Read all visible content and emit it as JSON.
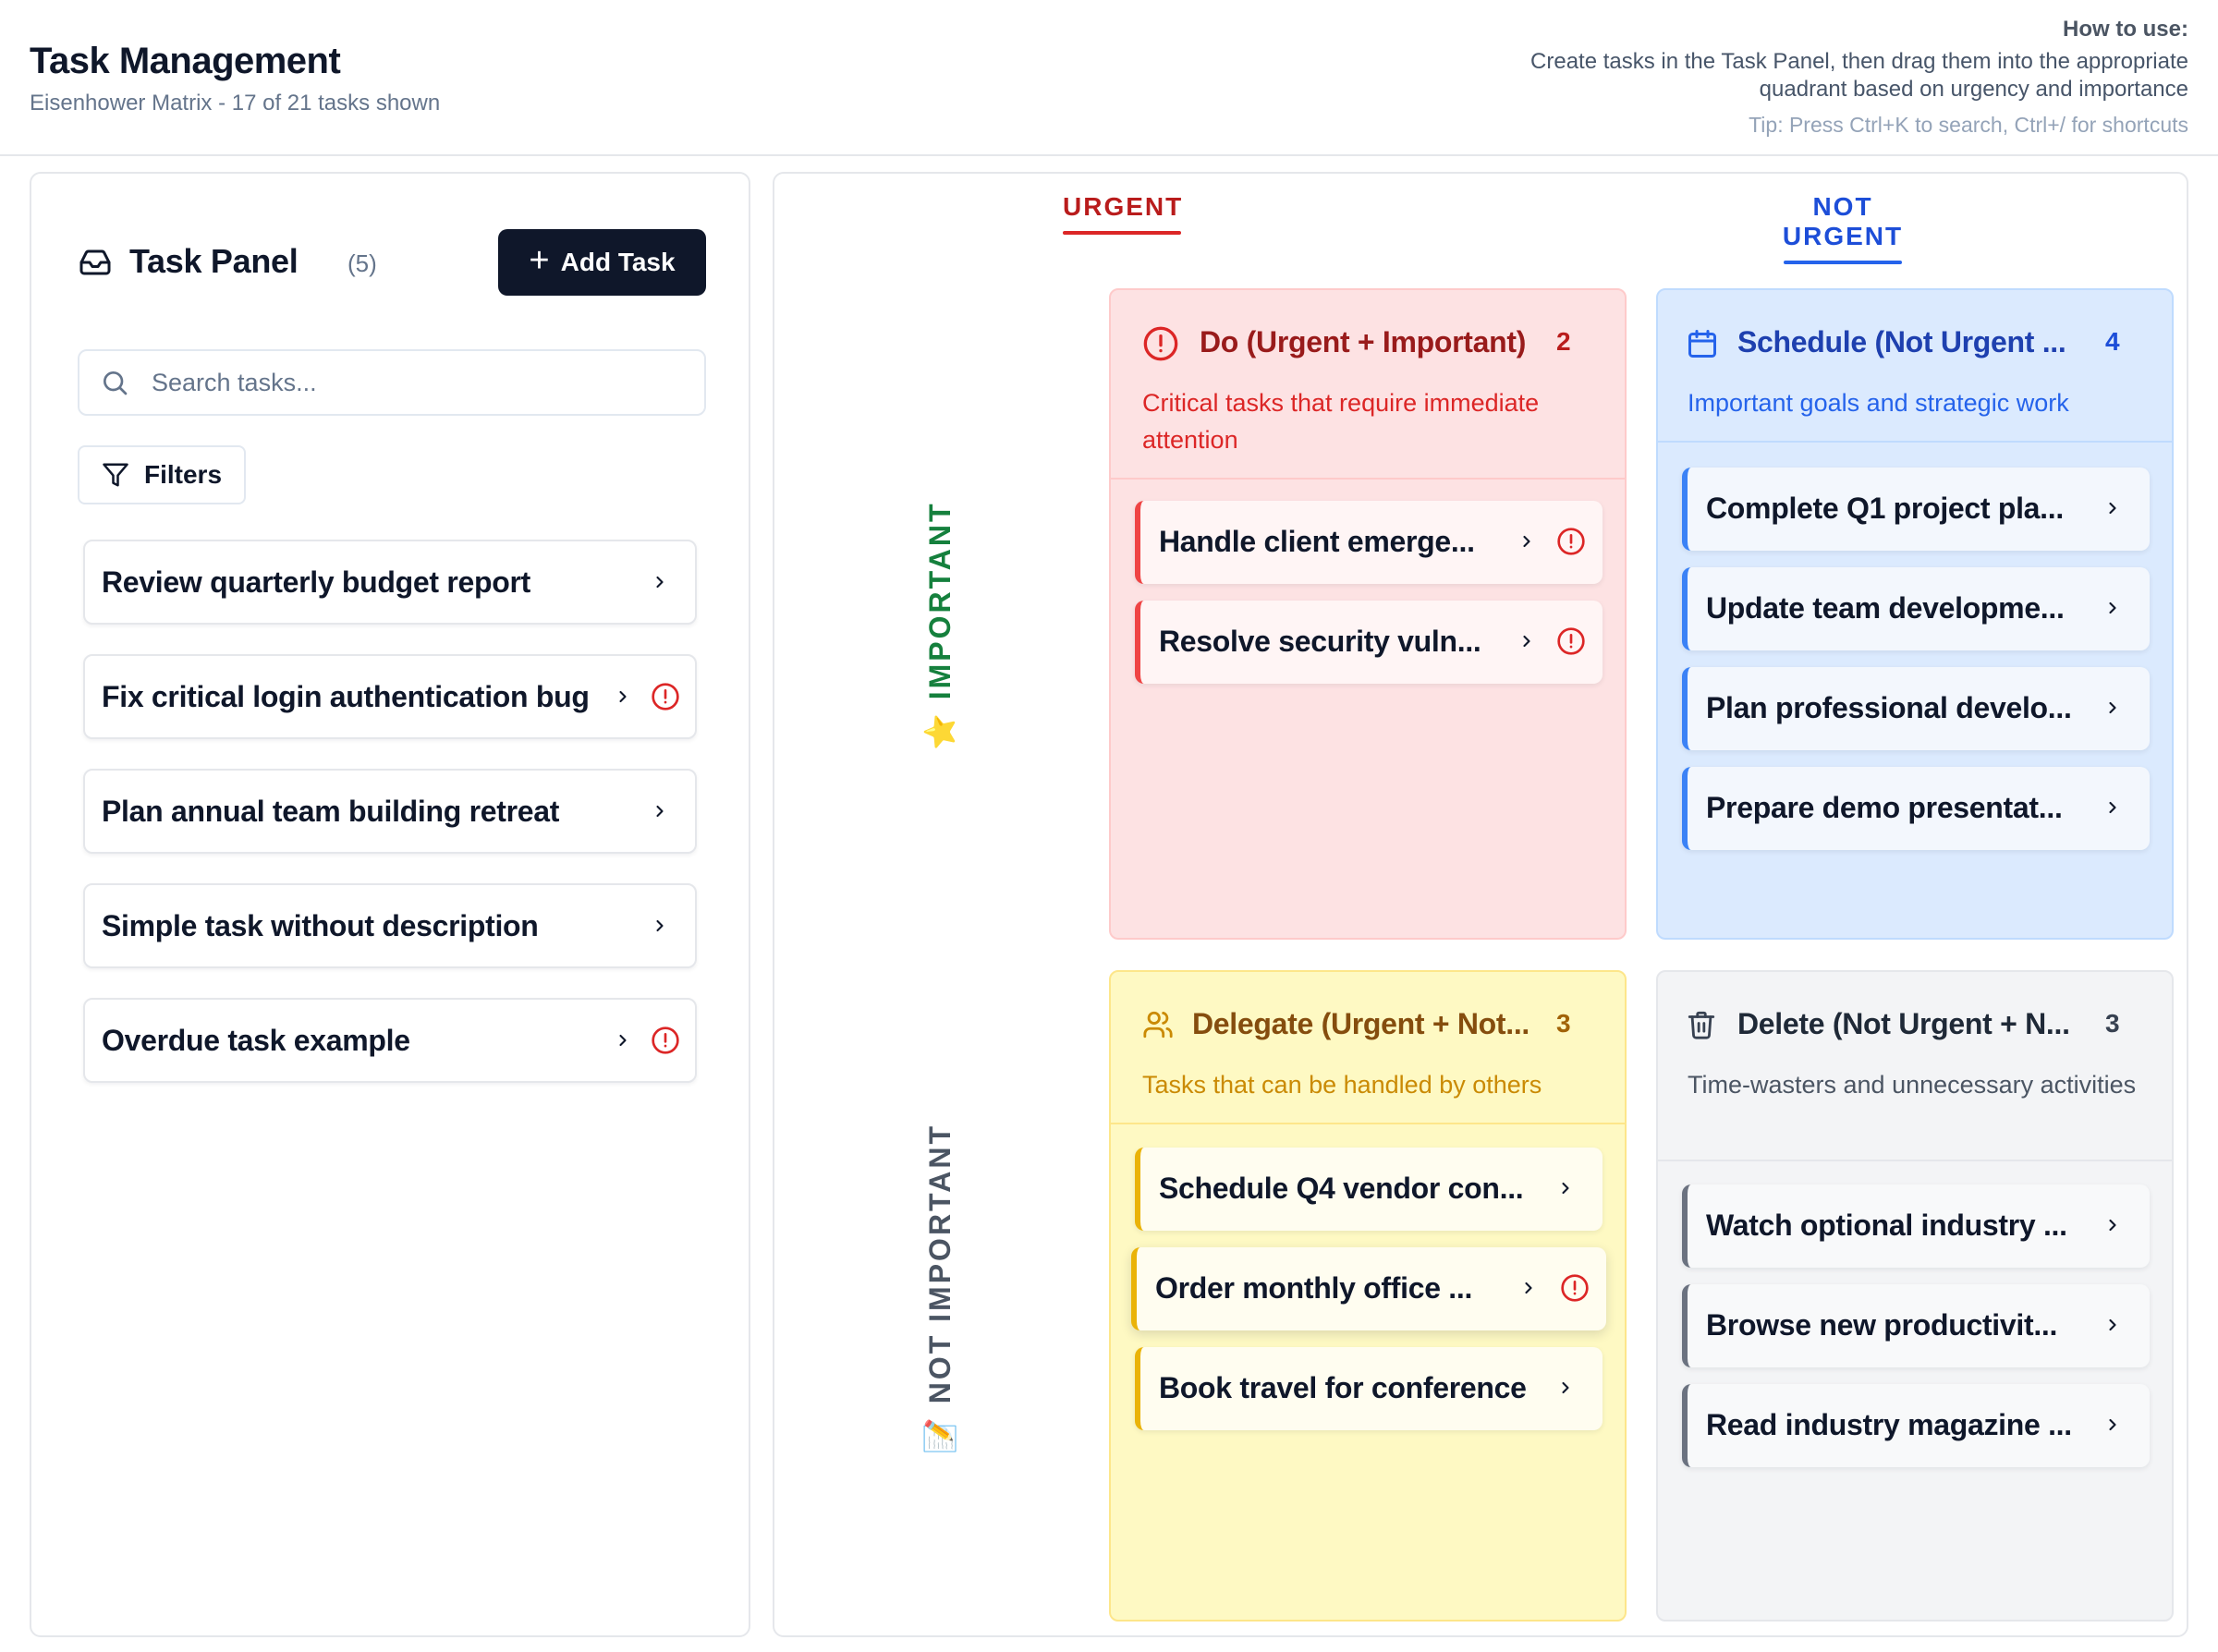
{
  "header": {
    "title": "Task Management",
    "subtitle": "Eisenhower Matrix - 17 of 21 tasks shown",
    "howto_heading": "How to use:",
    "howto_line1": "Create tasks in the Task Panel, then drag them into the appropriate",
    "howto_line2": "quadrant based on urgency and importance",
    "tip": "Tip: Press Ctrl+K to search, Ctrl+/ for shortcuts"
  },
  "panel": {
    "title": "Task Panel",
    "count": "(5)",
    "add_label": "Add Task",
    "search_placeholder": "Search tasks...",
    "filters_label": "Filters",
    "tasks": [
      {
        "title": "Review quarterly budget report",
        "alert": false
      },
      {
        "title": "Fix critical login authentication bug",
        "alert": true
      },
      {
        "title": "Plan annual team building retreat",
        "alert": false
      },
      {
        "title": "Simple task without description",
        "alert": false
      },
      {
        "title": "Overdue task example",
        "alert": true
      }
    ]
  },
  "matrix": {
    "col_urgent": "URGENT",
    "col_not_urgent": "NOT URGENT",
    "row_important": "⭐ IMPORTANT",
    "row_not_important": "📝 NOT IMPORTANT",
    "colors": {
      "urgent": "#b91c1c",
      "not_urgent": "#1d4ed8",
      "important": "#15803d",
      "not_important": "#4b5563"
    },
    "quadrants": {
      "do": {
        "icon": "alert-circle-icon",
        "title": "Do (Urgent + Important)",
        "count": "2",
        "description": "Critical tasks that require immediate attention",
        "tasks": [
          {
            "title": "Handle client emerge...",
            "alert": true
          },
          {
            "title": "Resolve security vuln...",
            "alert": true
          }
        ]
      },
      "schedule": {
        "icon": "calendar-icon",
        "title": "Schedule (Not Urgent ...",
        "count": "4",
        "description": "Important goals and strategic work",
        "tasks": [
          {
            "title": "Complete Q1 project pla...",
            "alert": false
          },
          {
            "title": "Update team developme...",
            "alert": false
          },
          {
            "title": "Plan professional develo...",
            "alert": false
          },
          {
            "title": "Prepare demo presentat...",
            "alert": false
          }
        ]
      },
      "delegate": {
        "icon": "users-icon",
        "title": "Delegate (Urgent + Not...",
        "count": "3",
        "description": "Tasks that can be handled by others",
        "tasks": [
          {
            "title": "Schedule Q4 vendor con...",
            "alert": false
          },
          {
            "title": "Order monthly office ...",
            "alert": true
          },
          {
            "title": "Book travel for conference",
            "alert": false
          }
        ]
      },
      "delete": {
        "icon": "trash-icon",
        "title": "Delete (Not Urgent + N...",
        "count": "3",
        "description": "Time-wasters and unnecessary activities",
        "tasks": [
          {
            "title": "Watch optional industry ...",
            "alert": false
          },
          {
            "title": "Browse new productivit...",
            "alert": false
          },
          {
            "title": "Read industry magazine ...",
            "alert": false
          }
        ]
      }
    }
  }
}
